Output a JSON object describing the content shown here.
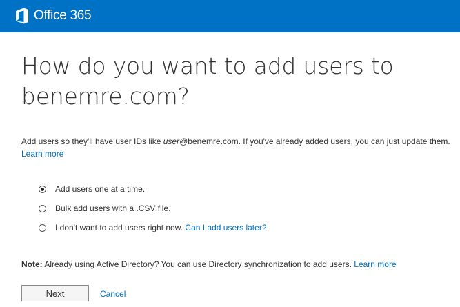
{
  "header": {
    "brand": "Office 365",
    "logo_icon": "office-logo-icon",
    "background": "#0072c6"
  },
  "title": "How do you want to add users to benemre.com?",
  "description": {
    "part1": "Add users so they'll have user IDs like ",
    "user_placeholder": "user",
    "part2": "@benemre.com. If you've already added users, you can just update them.",
    "learn_more": "Learn more"
  },
  "options": [
    {
      "label": "Add users one at a time.",
      "checked": true
    },
    {
      "label": "Bulk add users with a .CSV file.",
      "checked": false
    },
    {
      "label": "I don't want to add users right now.",
      "link": "Can I add users later?",
      "checked": false
    }
  ],
  "note": {
    "label": "Note:",
    "text": "Already using Active Directory? You can use Directory synchronization to add users.",
    "learn_more": "Learn more"
  },
  "actions": {
    "next": "Next",
    "cancel": "Cancel"
  },
  "colors": {
    "accent": "#0072c6",
    "text": "#333333"
  }
}
